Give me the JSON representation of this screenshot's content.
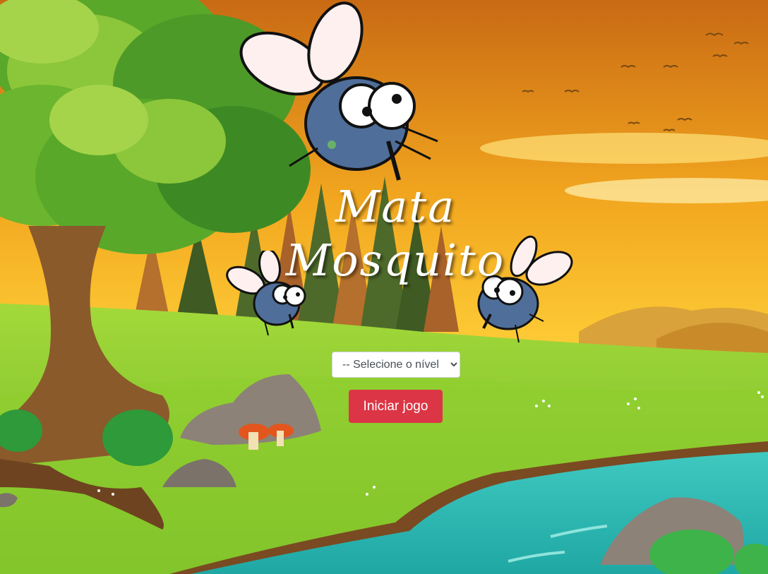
{
  "game": {
    "title_line1": "Mata",
    "title_line2": "Mosquito"
  },
  "level_select": {
    "selected": "-- Selecione o nível --",
    "options": [
      "-- Selecione o nível --"
    ]
  },
  "start_button": {
    "label": "Iniciar jogo",
    "color": "#dc3545"
  },
  "colors": {
    "sky_top": "#e08a1e",
    "sky_bottom": "#ffd23a",
    "grass": "#8fce2e",
    "water": "#2bbab0",
    "mosquito_body": "#4f6f9a"
  }
}
